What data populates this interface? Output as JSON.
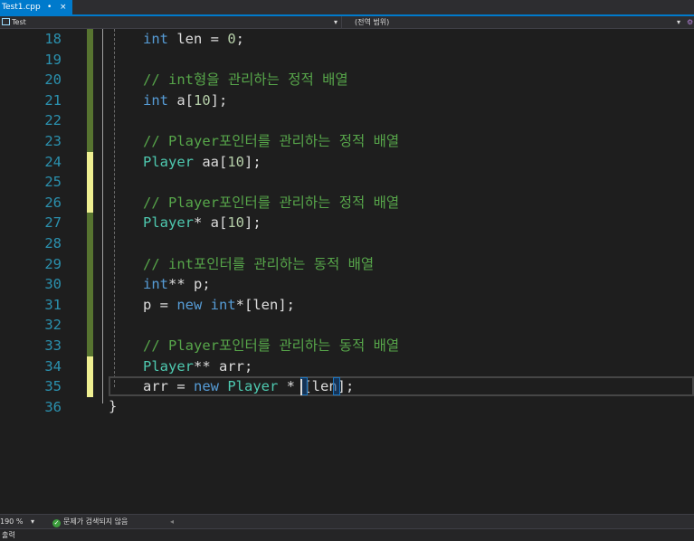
{
  "tab": {
    "filename": "Test1.cpp",
    "pin": "•",
    "close": "×"
  },
  "nav": {
    "project": "Test",
    "scope": "(전역 범위)",
    "dropdown": "▾"
  },
  "code_lines": [
    {
      "n": "18",
      "mark": "green",
      "tokens": [
        {
          "c": "kw",
          "t": "int"
        },
        {
          "c": "",
          "t": " len = "
        },
        {
          "c": "nm",
          "t": "0"
        },
        {
          "c": "",
          "t": ";"
        }
      ]
    },
    {
      "n": "19",
      "mark": "green",
      "tokens": []
    },
    {
      "n": "20",
      "mark": "green",
      "tokens": [
        {
          "c": "cm",
          "t": "// int형을 관리하는 정적 배열"
        }
      ]
    },
    {
      "n": "21",
      "mark": "green",
      "tokens": [
        {
          "c": "kw",
          "t": "int"
        },
        {
          "c": "",
          "t": " a["
        },
        {
          "c": "nm",
          "t": "10"
        },
        {
          "c": "",
          "t": "];"
        }
      ]
    },
    {
      "n": "22",
      "mark": "green",
      "tokens": []
    },
    {
      "n": "23",
      "mark": "green",
      "tokens": [
        {
          "c": "cm",
          "t": "// Player포인터를 관리하는 정적 배열"
        }
      ]
    },
    {
      "n": "24",
      "mark": "yellow",
      "tokens": [
        {
          "c": "ty",
          "t": "Player"
        },
        {
          "c": "",
          "t": " aa["
        },
        {
          "c": "nm",
          "t": "10"
        },
        {
          "c": "",
          "t": "];"
        }
      ]
    },
    {
      "n": "25",
      "mark": "yellow",
      "tokens": []
    },
    {
      "n": "26",
      "mark": "yellow",
      "tokens": [
        {
          "c": "cm",
          "t": "// Player포인터를 관리하는 정적 배열"
        }
      ]
    },
    {
      "n": "27",
      "mark": "green",
      "tokens": [
        {
          "c": "ty",
          "t": "Player"
        },
        {
          "c": "",
          "t": "* a["
        },
        {
          "c": "nm",
          "t": "10"
        },
        {
          "c": "",
          "t": "];"
        }
      ]
    },
    {
      "n": "28",
      "mark": "green",
      "tokens": []
    },
    {
      "n": "29",
      "mark": "green",
      "tokens": [
        {
          "c": "cm",
          "t": "// int포인터를 관리하는 동적 배열"
        }
      ]
    },
    {
      "n": "30",
      "mark": "green",
      "tokens": [
        {
          "c": "kw",
          "t": "int"
        },
        {
          "c": "",
          "t": "** p;"
        }
      ]
    },
    {
      "n": "31",
      "mark": "green",
      "tokens": [
        {
          "c": "",
          "t": "p = "
        },
        {
          "c": "kw",
          "t": "new"
        },
        {
          "c": "",
          "t": " "
        },
        {
          "c": "kw",
          "t": "int"
        },
        {
          "c": "",
          "t": "*[len];"
        }
      ]
    },
    {
      "n": "32",
      "mark": "green",
      "tokens": []
    },
    {
      "n": "33",
      "mark": "green",
      "tokens": [
        {
          "c": "cm",
          "t": "// Player포인터를 관리하는 동적 배열"
        }
      ]
    },
    {
      "n": "34",
      "mark": "yellow",
      "tokens": [
        {
          "c": "ty",
          "t": "Player"
        },
        {
          "c": "",
          "t": "** arr;"
        }
      ]
    },
    {
      "n": "35",
      "mark": "yellow",
      "tokens": [
        {
          "c": "",
          "t": "arr = "
        },
        {
          "c": "kw",
          "t": "new"
        },
        {
          "c": "",
          "t": " "
        },
        {
          "c": "ty",
          "t": "Player"
        },
        {
          "c": "",
          "t": " * [len];"
        }
      ]
    },
    {
      "n": "36",
      "mark": "none",
      "tokens": []
    }
  ],
  "closing_brace": "}",
  "status": {
    "zoom": "190 %",
    "zoom_dropdown": "▾",
    "issues": "문제가 검색되지 않음",
    "issues_icon": "✓",
    "scroll_arrow": "◂"
  },
  "bottom_panel": {
    "label": "출력"
  },
  "colors": {
    "accent": "#007acc",
    "keyword": "#569cd6",
    "type": "#4ec9b0",
    "comment": "#57a64a",
    "number": "#b5cea8",
    "line_number": "#2b91af",
    "change_saved": "#577430",
    "change_unsaved": "#efef91"
  }
}
